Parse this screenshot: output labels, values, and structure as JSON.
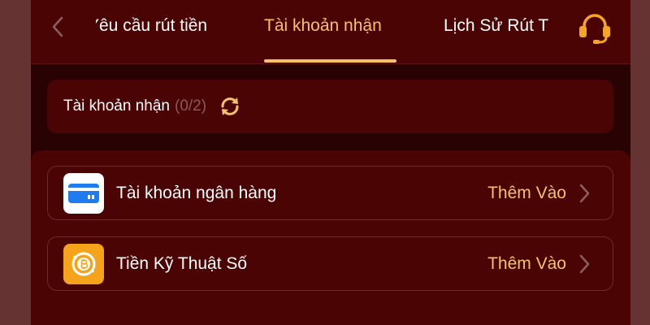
{
  "header": {
    "tabs": [
      {
        "label": "Yêu cầu rút tiền",
        "active": false
      },
      {
        "label": "Tài khoản nhận",
        "active": true
      },
      {
        "label": "Lịch Sử Rút T",
        "active": false
      }
    ],
    "icons": {
      "back": "chevron-left-icon",
      "support": "headset-icon"
    }
  },
  "accounts_bar": {
    "label": "Tài khoản nhận",
    "count": "(0/2)",
    "icon": "refresh-icon"
  },
  "options": [
    {
      "label": "Tài khoản ngân hàng",
      "action": "Thêm Vào",
      "icon": "bank-card-icon"
    },
    {
      "label": "Tiền Kỹ Thuật Số",
      "action": "Thêm Vào",
      "icon": "bitcoin-icon"
    }
  ],
  "colors": {
    "accent": "#f5c26b",
    "header_bg": "#4a0404",
    "page_bg": "#290303",
    "outer_bg": "#663333",
    "muted_text": "#8a5a5a",
    "crypto_icon_bg": "#f4a31a"
  }
}
